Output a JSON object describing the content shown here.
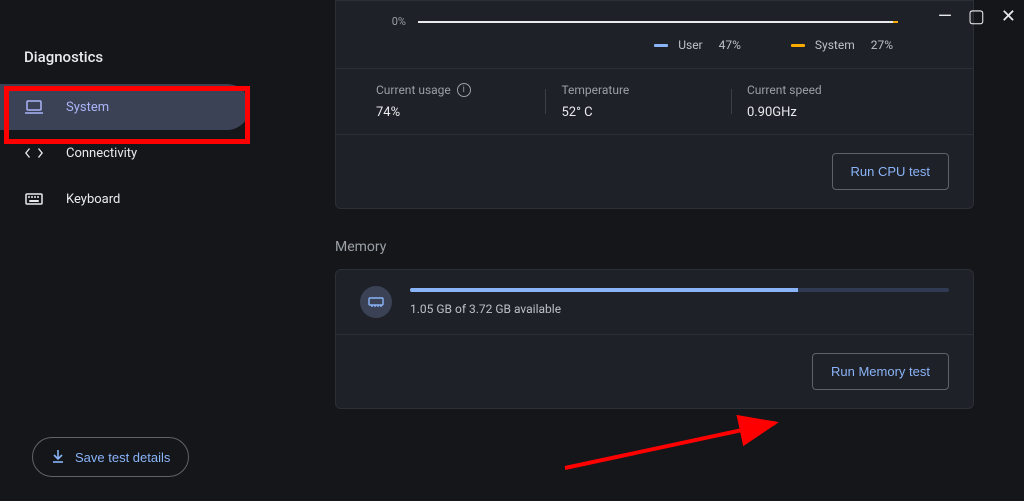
{
  "window_title": "Diagnostics",
  "sidebar": {
    "items": [
      {
        "label": "System"
      },
      {
        "label": "Connectivity"
      },
      {
        "label": "Keyboard"
      }
    ]
  },
  "save_test_details_label": "Save test details",
  "cpu": {
    "chart_axis_label": "0%",
    "legend": {
      "user_label": "User",
      "user_value": "47%",
      "system_label": "System",
      "system_value": "27%"
    },
    "stats": {
      "current_usage_label": "Current usage",
      "current_usage_value": "74%",
      "temperature_label": "Temperature",
      "temperature_value": "52° C",
      "current_speed_label": "Current speed",
      "current_speed_value": "0.90GHz"
    },
    "run_label": "Run CPU test"
  },
  "memory": {
    "section_title": "Memory",
    "available_text": "1.05 GB of 3.72 GB available",
    "run_label": "Run Memory test"
  },
  "chart_data": {
    "type": "line",
    "note": "CPU utilization over time — only baseline visible at 0% in cropped view",
    "series": [
      {
        "name": "User",
        "latest_value": 47,
        "color": "#8ab4f8"
      },
      {
        "name": "System",
        "latest_value": 27,
        "color": "#f9ab00"
      }
    ],
    "ylim": [
      0,
      100
    ],
    "ylabel": "%"
  }
}
